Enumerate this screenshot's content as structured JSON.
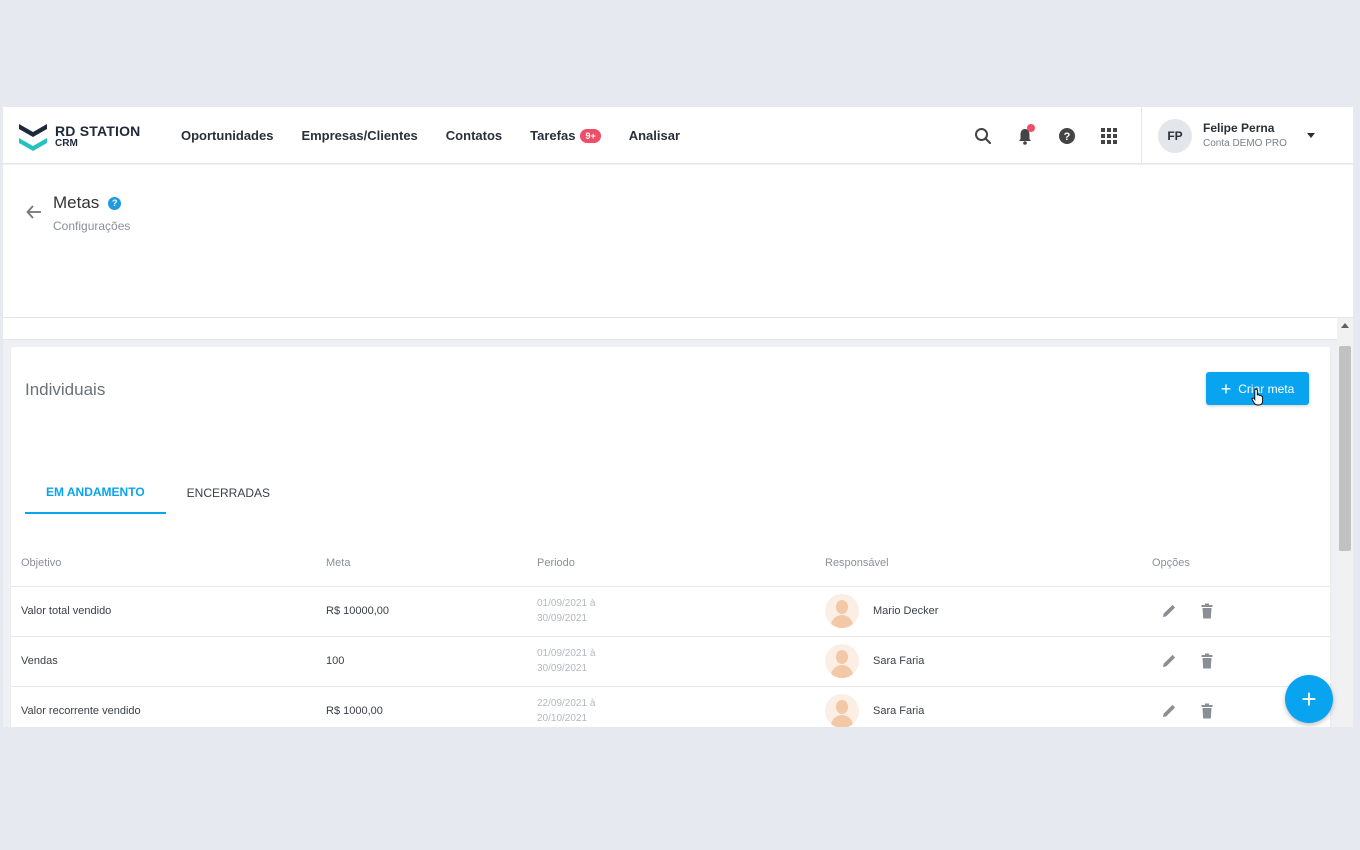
{
  "brand": {
    "line1": "RD STATION",
    "line2": "CRM",
    "colors": {
      "accent": "#08a4f0",
      "badge": "#f04e66",
      "logo_top": "#1e2a3a",
      "logo_bottom": "#27c2c0"
    }
  },
  "nav": {
    "items": [
      {
        "label": "Oportunidades"
      },
      {
        "label": "Empresas/Clientes"
      },
      {
        "label": "Contatos"
      },
      {
        "label": "Tarefas",
        "badge": "9+"
      },
      {
        "label": "Analisar"
      }
    ]
  },
  "header_icons": [
    "search-icon",
    "bell-icon",
    "help-icon",
    "apps-grid-icon"
  ],
  "user": {
    "initials": "FP",
    "name": "Felipe Perna",
    "account": "Conta DEMO PRO"
  },
  "page": {
    "title": "Metas",
    "subtitle": "Configurações"
  },
  "card": {
    "title": "Individuais",
    "create_label": "Criar meta",
    "tabs": [
      {
        "label": "EM ANDAMENTO",
        "active": true
      },
      {
        "label": "ENCERRADAS",
        "active": false
      }
    ],
    "columns": [
      "Objetivo",
      "Meta",
      "Periodo",
      "Responsável",
      "Opções"
    ],
    "rows": [
      {
        "objetivo": "Valor total vendido",
        "meta": "R$ 10000,00",
        "period_start": "01/09/2021 à",
        "period_end": "30/09/2021",
        "responsavel": "Mario Decker"
      },
      {
        "objetivo": "Vendas",
        "meta": "100",
        "period_start": "01/09/2021 à",
        "period_end": "30/09/2021",
        "responsavel": "Sara Faria"
      },
      {
        "objetivo": "Valor recorrente vendido",
        "meta": "R$ 1000,00",
        "period_start": "22/09/2021 à",
        "period_end": "20/10/2021",
        "responsavel": "Sara Faria"
      }
    ]
  },
  "fab": {
    "label": "+"
  }
}
